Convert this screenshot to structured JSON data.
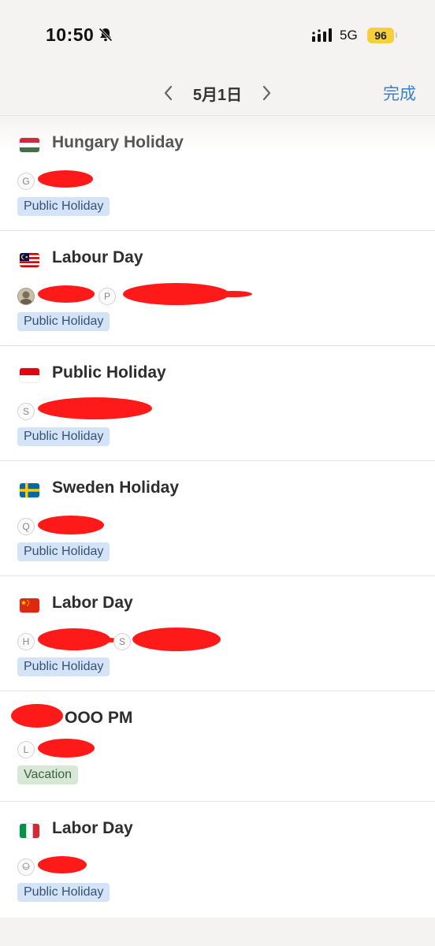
{
  "status_bar": {
    "time": "10:50",
    "network": "5G",
    "battery": "96",
    "icons": [
      "bell-slash-icon",
      "signal-icon"
    ]
  },
  "nav": {
    "title": "5月1日",
    "done_label": "完成",
    "icons": [
      "chevron-left-icon",
      "chevron-right-icon"
    ]
  },
  "colors": {
    "accent": "#3a80c6",
    "public_holiday_tag_bg": "#d4e3f5",
    "vacation_tag_bg": "#d8e8d6",
    "battery": "#f5cf3c"
  },
  "events": [
    {
      "flag": "hungary-flag",
      "title": "Hungary Holiday",
      "attendees": [
        {
          "initial": "G"
        }
      ],
      "tag": "Public Holiday"
    },
    {
      "flag": "malaysia-flag",
      "title": "Labour Day",
      "attendees": [
        {
          "initial": ""
        },
        {
          "initial": "P"
        }
      ],
      "tag": "Public Holiday"
    },
    {
      "flag": "indonesia-flag",
      "title": "Public Holiday",
      "attendees": [
        {
          "initial": "S"
        }
      ],
      "tag": "Public Holiday"
    },
    {
      "flag": "sweden-flag",
      "title": "Sweden Holiday",
      "attendees": [
        {
          "initial": "Q"
        }
      ],
      "tag": "Public Holiday"
    },
    {
      "flag": "china-flag",
      "title": "Labor Day",
      "attendees": [
        {
          "initial": "H"
        },
        {
          "initial": "S"
        }
      ],
      "tag": "Public Holiday"
    },
    {
      "flag": "",
      "title": "OOO PM",
      "attendees": [
        {
          "initial": "L"
        }
      ],
      "tag": "Vacation"
    },
    {
      "flag": "italy-flag",
      "title": "Labor Day",
      "attendees": [
        {
          "initial": ""
        }
      ],
      "tag": "Public Holiday"
    }
  ]
}
